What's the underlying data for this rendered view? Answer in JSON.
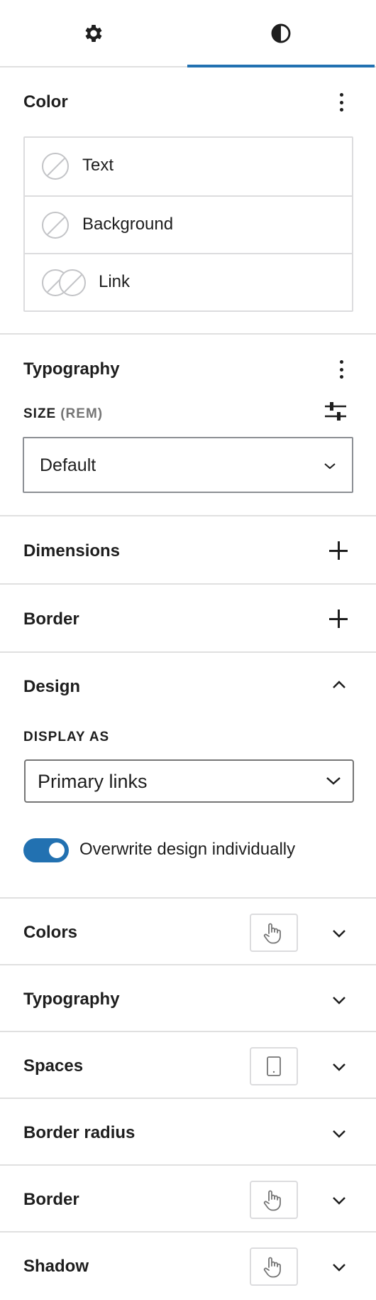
{
  "tabs": [
    {
      "icon": "gear-icon",
      "label": "Settings"
    },
    {
      "icon": "contrast-icon",
      "label": "Styles",
      "active": true
    }
  ],
  "color": {
    "title": "Color",
    "items": [
      {
        "label": "Text"
      },
      {
        "label": "Background"
      },
      {
        "label": "Link"
      }
    ]
  },
  "typography": {
    "title": "Typography",
    "size_label": "SIZE",
    "size_unit": "(REM)",
    "size_value": "Default"
  },
  "dimensions": {
    "title": "Dimensions"
  },
  "border": {
    "title": "Border"
  },
  "design": {
    "title": "Design",
    "display_as_label": "DISPLAY AS",
    "display_as_value": "Primary links",
    "toggle_label": "Overwrite design individually",
    "toggle_on": true
  },
  "design_sections": [
    {
      "title": "Colors",
      "device_icon": "pointer-hand-icon"
    },
    {
      "title": "Typography",
      "device_icon": ""
    },
    {
      "title": "Spaces",
      "device_icon": "mobile-device-icon"
    },
    {
      "title": "Border radius",
      "device_icon": ""
    },
    {
      "title": "Border",
      "device_icon": "pointer-hand-icon"
    },
    {
      "title": "Shadow",
      "device_icon": "pointer-hand-icon"
    }
  ],
  "colors": {
    "accent": "#2271b1",
    "text": "#1e1e1e",
    "muted": "#757575",
    "border": "#dcdcde"
  }
}
